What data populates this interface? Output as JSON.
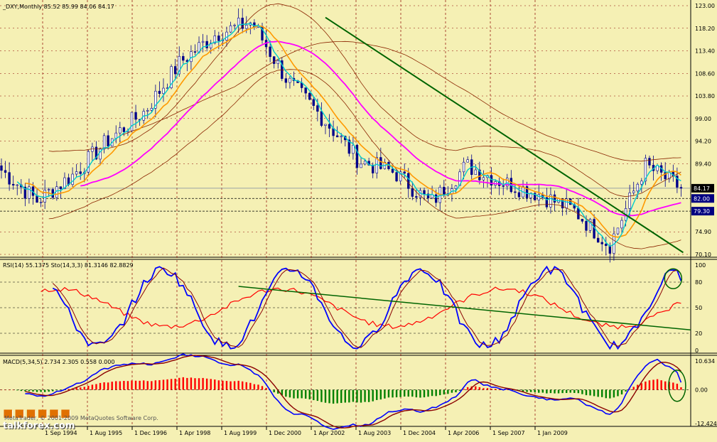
{
  "panels": {
    "main": {
      "header": "_DXY,Monthly  85.52 85.99 84.06 84.17",
      "axis_ticks": [
        "123.00",
        "118.20",
        "113.40",
        "108.60",
        "103.80",
        "99.00",
        "94.20",
        "89.40",
        "84.17",
        "82.00",
        "79.30",
        "74.90",
        "70.10"
      ]
    },
    "rsi": {
      "header": "RSI(14) 55.1375  Sto(14,3,3) 81.3146 82.8829",
      "axis_ticks": [
        "100",
        "80",
        "50",
        "20",
        "0"
      ]
    },
    "macd": {
      "header": "MACD(5,34,5) 2.734 2.305 0.558 0.000",
      "axis_ticks": [
        "10.634",
        "0.00",
        "-12.424"
      ]
    }
  },
  "x_axis_labels": [
    "1 Sep 1994",
    "1 Aug 1995",
    "1 Dec 1996",
    "1 Apr 1998",
    "1 Aug 1999",
    "1 Dec 2000",
    "1 Apr 2002",
    "1 Aug 2003",
    "1 Dec 2004",
    "1 Apr 2006",
    "1 Sep 2007",
    "1 Jan 2009"
  ],
  "price_tags": [
    {
      "value": "84.17",
      "bg": "#000000",
      "fg": "#ffffff"
    },
    {
      "value": "82.00",
      "bg": "#000080",
      "fg": "#ffffff"
    },
    {
      "value": "79.30",
      "bg": "#000080",
      "fg": "#ffffff"
    }
  ],
  "watermark": {
    "brand": "talkforex.com",
    "copyright": "MetaTrader, © 2001-2009 MetaQuotes Software Corp."
  },
  "colors": {
    "background": "#f5f0b4",
    "grid": "#8b0000",
    "bull": "#00008b",
    "bear": "#00008b",
    "ma_fast": "#00cccc",
    "ma_mid": "#ff9900",
    "ma_slow": "#ff00ff",
    "envelope": "#8b2500",
    "trend": "#006400",
    "rsi": "#0000ff",
    "sto": "#ff0000",
    "macd_main": "#0000ff",
    "macd_signal": "#8b0000",
    "hist_pos": "#ff0000",
    "hist_neg": "#008000"
  },
  "chart_data": [
    {
      "type": "candlestick",
      "title": "_DXY,Monthly",
      "ohlc_last": {
        "open": 85.52,
        "high": 85.99,
        "low": 84.06,
        "close": 84.17
      },
      "ylim": [
        70.1,
        123.0
      ],
      "x": [
        "1994-09",
        "1995-08",
        "1996-12",
        "1998-04",
        "1999-08",
        "2000-12",
        "2002-04",
        "2003-08",
        "2004-12",
        "2006-04",
        "2007-09",
        "2009-01"
      ],
      "close_anchors": [
        88.0,
        81.5,
        87.0,
        94.5,
        100.5,
        111.0,
        117.0,
        119.5,
        107.0,
        99.0,
        90.0,
        87.5,
        81.0,
        89.0,
        85.5,
        83.0,
        79.5,
        72.0,
        89.0,
        84.17
      ],
      "horizontal_levels": [
        84.17,
        82.0,
        79.3
      ],
      "series": [
        {
          "name": "ma_fast",
          "values": []
        },
        {
          "name": "ma_mid",
          "values": []
        },
        {
          "name": "ma_slow",
          "values": []
        }
      ],
      "trendline": {
        "from": [
          "2001-07",
          120.5
        ],
        "to": [
          "2009-01",
          70.5
        ]
      }
    },
    {
      "type": "line",
      "title": "RSI(14) 55.1375  Sto(14,3,3) 81.3146 82.8829",
      "ylim": [
        0,
        100
      ],
      "levels": [
        80,
        50,
        20
      ],
      "series": [
        {
          "name": "RSI(14)",
          "last": 55.1375
        },
        {
          "name": "Sto(14,3,3)",
          "last": 81.3146
        },
        {
          "name": "Sto signal",
          "last": 82.8829
        }
      ]
    },
    {
      "type": "bar",
      "title": "MACD(5,34,5) 2.734 2.305 0.558 0.000",
      "ylim": [
        -12.424,
        10.634
      ],
      "series": [
        {
          "name": "MACD",
          "last": 2.734
        },
        {
          "name": "Signal",
          "last": 2.305
        },
        {
          "name": "Histogram",
          "last": 0.558
        }
      ]
    }
  ]
}
